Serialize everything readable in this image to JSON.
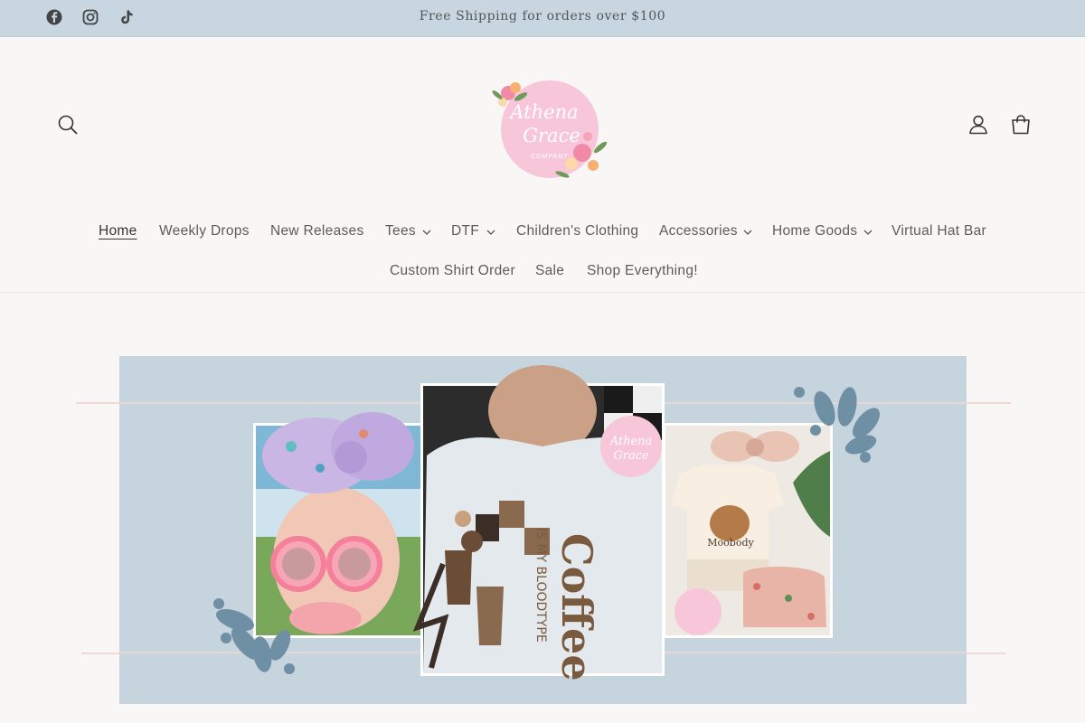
{
  "announcement": {
    "text": "Free Shipping for orders over $100",
    "social": [
      "facebook-icon",
      "instagram-icon",
      "tiktok-icon"
    ]
  },
  "header": {
    "logo": {
      "line1": "Athena",
      "line2": "Grace",
      "line3": "COMPANY"
    },
    "icons": [
      "search-icon",
      "account-icon",
      "cart-icon"
    ]
  },
  "nav": {
    "home": "Home",
    "weekly_drops": "Weekly Drops",
    "new_releases": "New Releases",
    "tees": "Tees",
    "dtf": "DTF",
    "childrens_clothing": "Children's Clothing",
    "accessories": "Accessories",
    "home_goods": "Home Goods",
    "virtual_hat_bar": "Virtual Hat Bar",
    "custom_shirt_order": "Custom Shirt Order",
    "sale": "Sale",
    "shop_everything": "Shop Everything!"
  },
  "hero": {
    "center_text_main": "Coffee",
    "center_text_sub": "IS MY BLOODTYPE",
    "shorts_text": "Moobody",
    "badge_line1": "Athena",
    "badge_line2": "Grace"
  },
  "colors": {
    "announcement_bg": "#c7d6e0",
    "page_bg": "#f8f7f5",
    "hero_bg": "#c5d4dd",
    "accent_blue": "#6f8fa4",
    "logo_pink": "#f7c6d9"
  }
}
